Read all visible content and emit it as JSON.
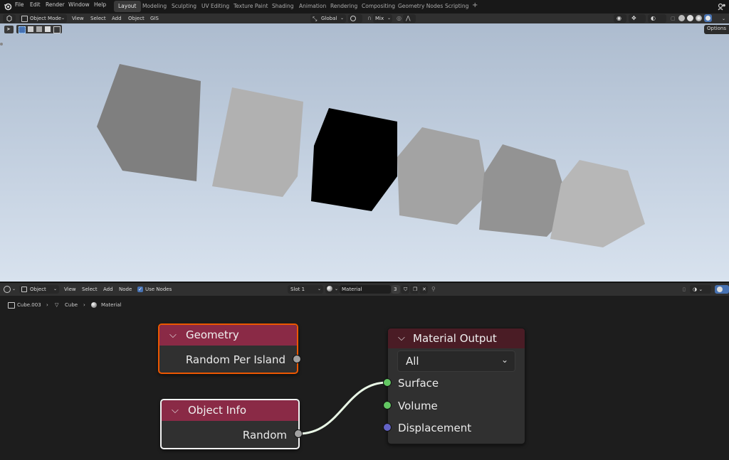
{
  "menu": [
    "File",
    "Edit",
    "Render",
    "Window",
    "Help"
  ],
  "workspaces": [
    {
      "label": "Layout",
      "active": true
    },
    {
      "label": "Modeling",
      "active": false
    },
    {
      "label": "Sculpting",
      "active": false
    },
    {
      "label": "UV Editing",
      "active": false
    },
    {
      "label": "Texture Paint",
      "active": false
    },
    {
      "label": "Shading",
      "active": false
    },
    {
      "label": "Animation",
      "active": false
    },
    {
      "label": "Rendering",
      "active": false
    },
    {
      "label": "Compositing",
      "active": false
    },
    {
      "label": "Geometry Nodes",
      "active": false
    },
    {
      "label": "Scripting",
      "active": false
    }
  ],
  "viewport_header": {
    "mode": "Object Mode",
    "menus": [
      "View",
      "Select",
      "Add",
      "Object",
      "GIS"
    ],
    "orientation": "Global",
    "snap_mode": "Mix",
    "options": "Options"
  },
  "node_header": {
    "mode": "Object",
    "menus": [
      "View",
      "Select",
      "Add",
      "Node"
    ],
    "use_nodes_label": "Use Nodes",
    "use_nodes_checked": true,
    "slot": "Slot 1",
    "material": "Material",
    "user_count": "3"
  },
  "breadcrumb": {
    "object": "Cube.003",
    "mesh": "Cube",
    "material": "Material"
  },
  "nodes": {
    "geometry": {
      "title": "Geometry",
      "output": "Random Per Island",
      "header_color": "#8a2a46"
    },
    "object_info": {
      "title": "Object Info",
      "output": "Random",
      "header_color": "#8a2a46"
    },
    "material_output": {
      "title": "Material Output",
      "target": "All",
      "inputs": [
        "Surface",
        "Volume",
        "Displacement"
      ],
      "header_color": "#4a1c25"
    }
  },
  "colors": {
    "accent": "#4772b3",
    "socket_shader": "#63c763",
    "socket_vector": "#6363c7",
    "socket_float": "#a1a1a1",
    "selected_outline": "#ed5700"
  }
}
